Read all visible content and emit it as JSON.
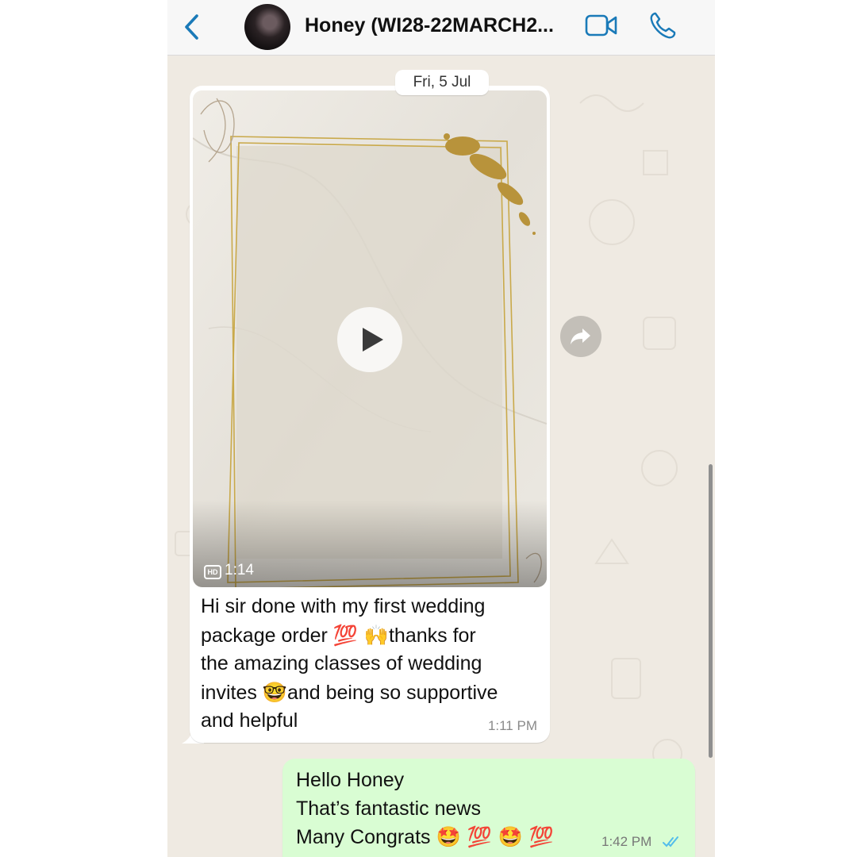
{
  "header": {
    "title": "Honey (WI28-22MARCH2...",
    "accent_color": "#1a7ab8"
  },
  "chat": {
    "date_separator": "Fri, 5 Jul",
    "incoming": {
      "video_duration": "1:14",
      "video_quality_badge": "HD",
      "text_line_1": "Hi sir done with my first wedding",
      "text_line_2_a": "package order ",
      "text_line_2_emoji": "💯 🙌",
      "text_line_2_b": "thanks for",
      "text_line_3": "the amazing classes of wedding",
      "text_line_4_a": "invites ",
      "text_line_4_emoji": "🤓",
      "text_line_4_b": "and being so supportive",
      "text_line_5": "and helpful",
      "time": "1:11 PM"
    },
    "outgoing": {
      "line_1": "Hello Honey",
      "line_2": "That’s fantastic news",
      "line_3": "Many Congrats ",
      "line_3_emoji": "🤩 💯 🤩 💯",
      "time": "1:42 PM",
      "bubble_color": "#d9fdd3",
      "tick_color": "#53bdeb"
    }
  }
}
